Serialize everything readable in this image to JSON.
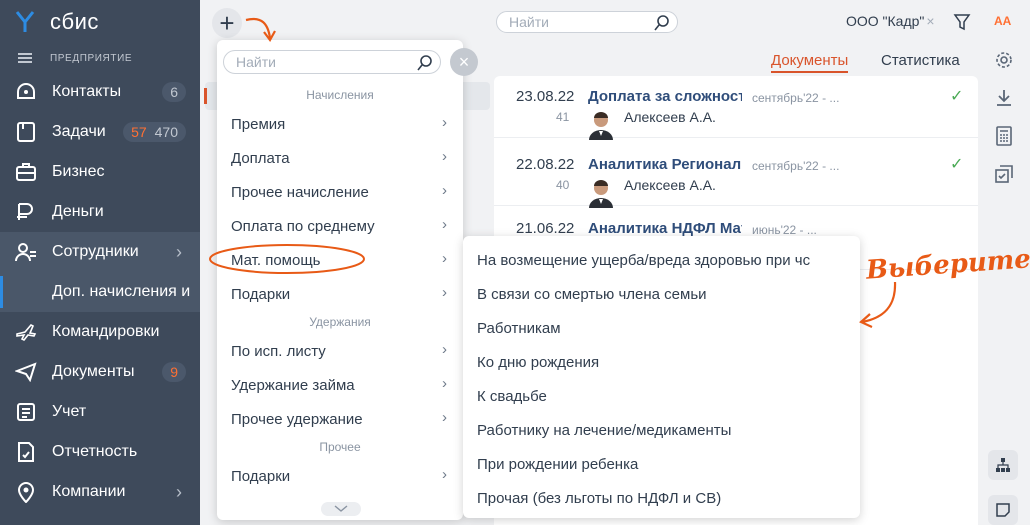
{
  "sidebar": {
    "logo": "сбис",
    "org_label": "ПРЕДПРИЯТИЕ",
    "items": [
      {
        "label": "Контакты",
        "count": "6",
        "icon": "contacts-icon"
      },
      {
        "label": "Задачи",
        "count_hot": "57",
        "count": "470",
        "icon": "tasks-icon"
      },
      {
        "label": "Бизнес",
        "icon": "business-icon"
      },
      {
        "label": "Деньги",
        "icon": "money-icon"
      },
      {
        "label": "Сотрудники",
        "icon": "employees-icon"
      },
      {
        "label": "Командировки",
        "icon": "trips-icon"
      },
      {
        "label": "Документы",
        "count": "9",
        "icon": "documents-icon"
      },
      {
        "label": "Учет",
        "icon": "accounting-icon"
      },
      {
        "label": "Отчетность",
        "icon": "reporting-icon"
      },
      {
        "label": "Компании",
        "icon": "companies-icon"
      }
    ],
    "sub_item": "Доп. начисления и"
  },
  "topbar": {
    "search_placeholder": "Найти",
    "org_filter": "ООО \"Кадр\"",
    "org_filter_close": "×",
    "font_size_label": "AA"
  },
  "tabs": [
    "Документы",
    "Статистика"
  ],
  "documents": [
    {
      "date": "23.08.22",
      "num": "41",
      "title": "Доплата за сложность",
      "period": "сентябрь'22 - ...",
      "person": "Алексеев А.А.",
      "signed": true
    },
    {
      "date": "22.08.22",
      "num": "40",
      "title": "Аналитика Региональ",
      "period": "сентябрь'22 - ...",
      "person": "Алексеев А.А.",
      "signed": true
    },
    {
      "date": "21.06.22",
      "num": "",
      "title": "Аналитика НДФЛ Матер",
      "period": "июнь'22 - ...",
      "person": "",
      "signed": false
    }
  ],
  "menu": {
    "search_placeholder": "Найти",
    "groups": [
      "Начисления",
      "Удержания",
      "Прочее"
    ],
    "accruals": [
      "Премия",
      "Доплата",
      "Прочее начисление",
      "Оплата по среднему",
      "Мат. помощь",
      "Подарки"
    ],
    "deductions": [
      "По исп. листу",
      "Удержание займа",
      "Прочее удержание"
    ],
    "other": [
      "Подарки"
    ],
    "arrow": "›"
  },
  "submenu": {
    "items": [
      "На возмещение ущерба/вреда здоровью при чс",
      "В связи со смертью члена семьи",
      "Работникам",
      "Ко дню рождения",
      "К свадьбе",
      "Работнику на лечение/медикаменты",
      "При рождении ребенка",
      "Прочая (без льготы по НДФЛ и СВ)"
    ]
  },
  "annotation": {
    "callout": "Выберите"
  },
  "colors": {
    "sidebar": "#3e4a5b",
    "accent": "#d9542b",
    "annotation": "#e85a16",
    "link": "#2f4d7a"
  }
}
